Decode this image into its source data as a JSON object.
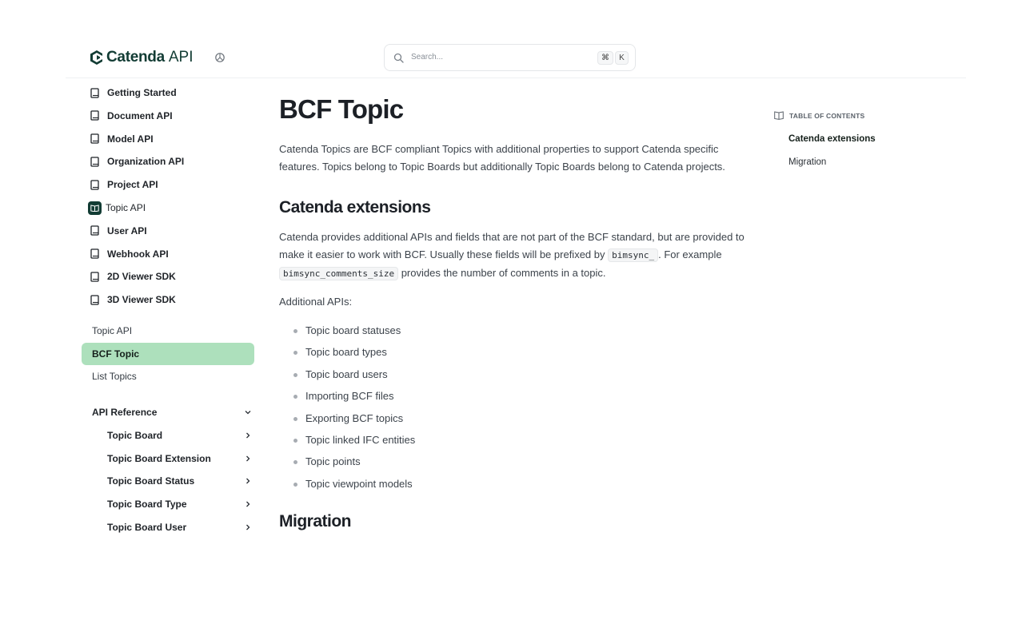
{
  "header": {
    "brand": "Catenda",
    "brand_suffix": "API",
    "search_placeholder": "Search...",
    "shortcut_keys": [
      "⌘",
      "K"
    ]
  },
  "sidebar": {
    "products": [
      {
        "label": "Getting Started",
        "icon": "book-icon"
      },
      {
        "label": "Document API",
        "icon": "book-icon"
      },
      {
        "label": "Model API",
        "icon": "book-icon"
      },
      {
        "label": "Organization API",
        "icon": "book-icon"
      },
      {
        "label": "Project API",
        "icon": "book-icon"
      },
      {
        "label": "Topic API",
        "icon": "open-book-icon",
        "active": true
      },
      {
        "label": "User API",
        "icon": "book-icon"
      },
      {
        "label": "Webhook API",
        "icon": "book-icon"
      },
      {
        "label": "2D Viewer SDK",
        "icon": "book-icon"
      },
      {
        "label": "3D Viewer SDK",
        "icon": "book-icon"
      }
    ],
    "pages": [
      {
        "label": "Topic API",
        "active": false
      },
      {
        "label": "BCF Topic",
        "active": true
      },
      {
        "label": "List Topics",
        "active": false
      }
    ],
    "reference": {
      "label": "API Reference",
      "items": [
        "Topic Board",
        "Topic Board Extension",
        "Topic Board Status",
        "Topic Board Type",
        "Topic Board User"
      ]
    }
  },
  "main": {
    "title": "BCF Topic",
    "intro": "Catenda Topics are BCF compliant Topics with additional properties to support Catenda specific features. Topics belong to Topic Boards but additionally Topic Boards belong to Catenda projects.",
    "section1": {
      "heading": "Catenda extensions",
      "text_before": "Catenda provides additional APIs and fields that are not part of the BCF standard, but are provided to make it easier to work with BCF. Usually these fields will be prefixed by ",
      "code1": "bimsync_",
      "text_middle": ". For example ",
      "code2": "bimsync_comments_size",
      "text_after": " provides the number of comments in a topic.",
      "apis_label": "Additional APIs:",
      "apis": [
        "Topic board statuses",
        "Topic board types",
        "Topic board users",
        "Importing BCF files",
        "Exporting BCF topics",
        "Topic linked IFC entities",
        "Topic points",
        "Topic viewpoint models"
      ]
    },
    "section2": {
      "heading": "Migration"
    }
  },
  "toc": {
    "title": "TABLE OF CONTENTS",
    "links": [
      {
        "label": "Catenda extensions",
        "active": true
      },
      {
        "label": "Migration",
        "active": false
      }
    ]
  },
  "colors": {
    "brand": "#123c34",
    "active_page_bg": "#ade0bc"
  }
}
